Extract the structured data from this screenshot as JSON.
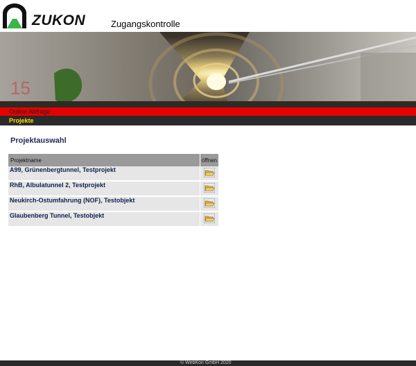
{
  "header": {
    "brand": "ZUKON",
    "subtitle": "Zugangskontrolle",
    "logo_icon": "tunnel-logo-icon"
  },
  "nav": {
    "primary": "Online Abfrage",
    "secondary": "Projekte",
    "primary_color": "#e60000",
    "secondary_color": "#ffdf00"
  },
  "main": {
    "title": "Projektauswahl",
    "table": {
      "headers": [
        "Projektname",
        "öffnen"
      ],
      "rows": [
        {
          "name": "A99, Grünenbergtunnel, Testprojekt",
          "action_icon": "open-folder-icon"
        },
        {
          "name": "RhB, Albulatunnel 2, Testprojekt",
          "action_icon": "open-folder-icon"
        },
        {
          "name": "Neukirch-Ostumfahrung (NOF), Testobjekt",
          "action_icon": "open-folder-icon"
        },
        {
          "name": "Glaubenberg Tunnel, Testobjekt",
          "action_icon": "open-folder-icon"
        }
      ]
    }
  },
  "footer": {
    "text": "© WebKon GmbH 2020"
  }
}
